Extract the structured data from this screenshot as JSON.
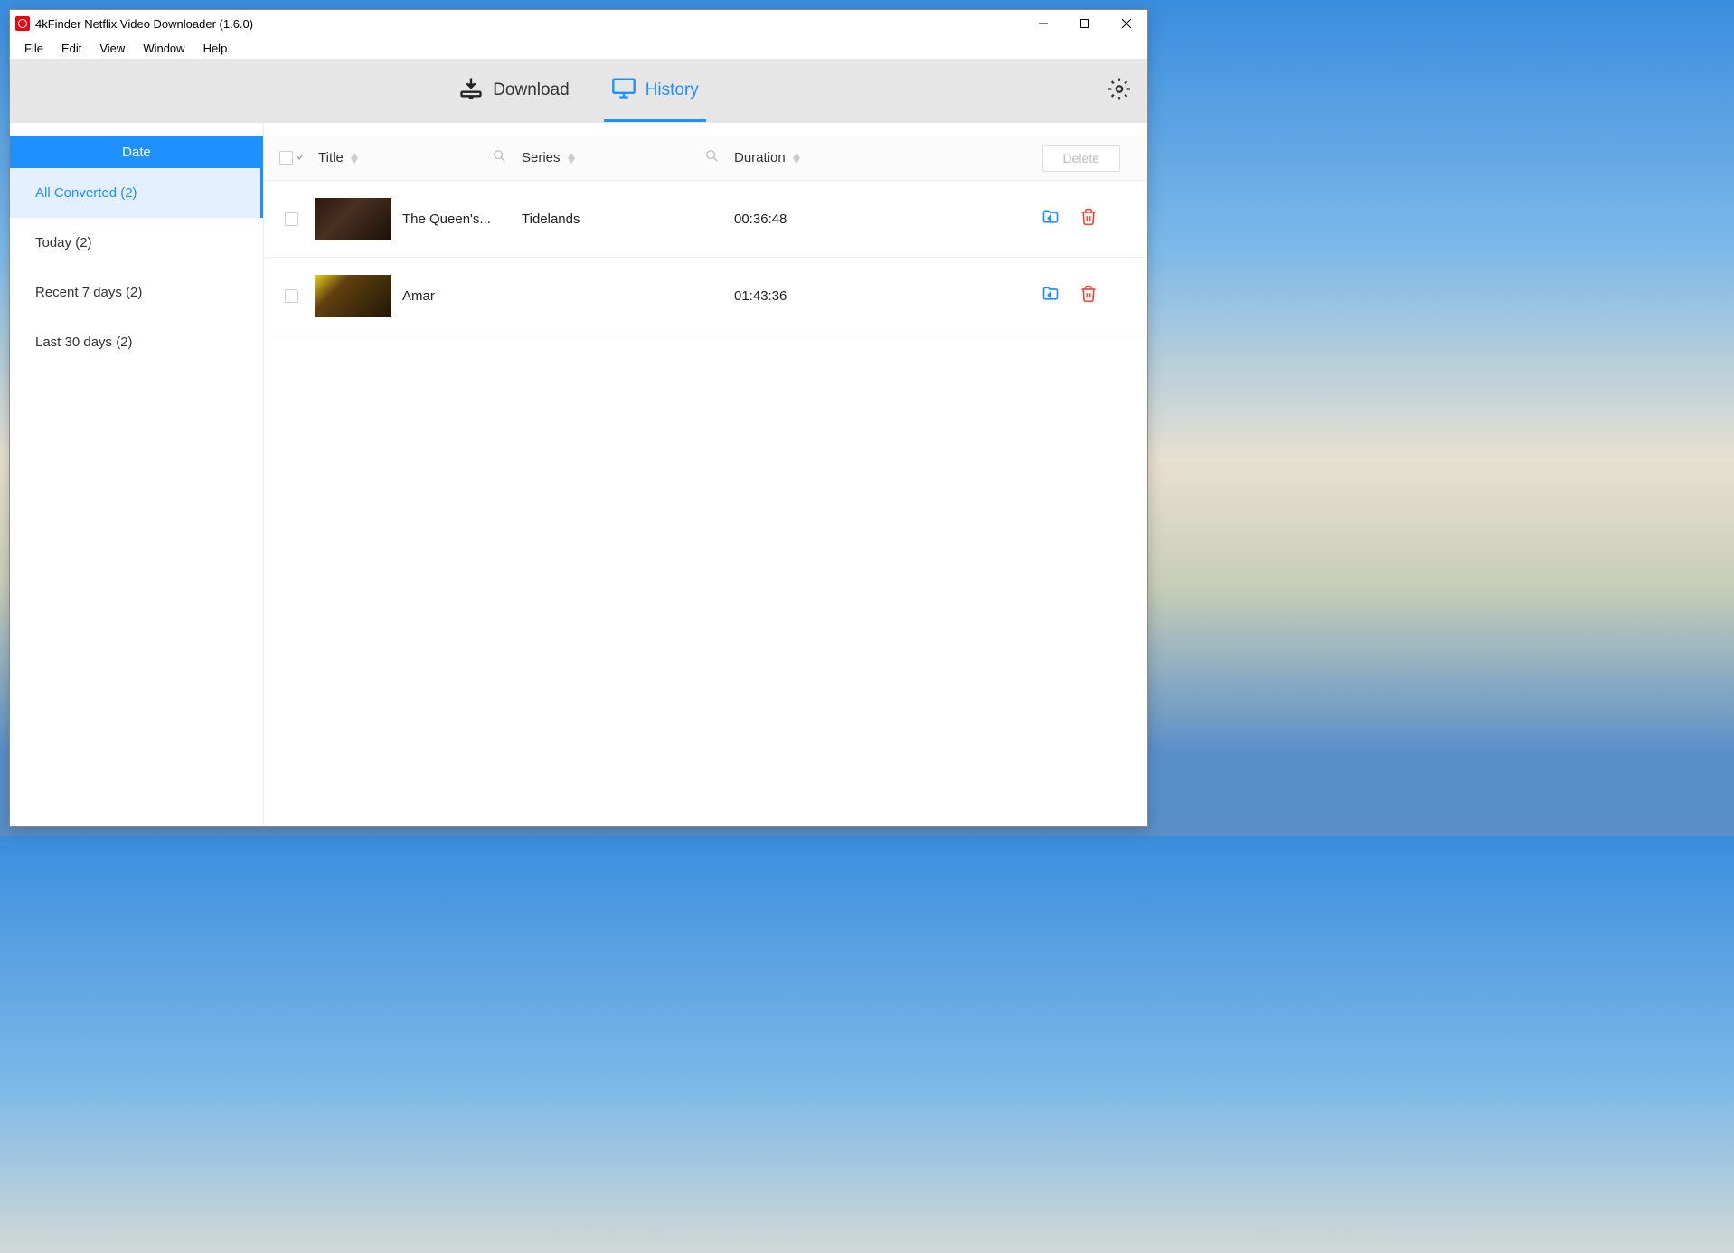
{
  "window": {
    "title": "4kFinder Netflix Video Downloader (1.6.0)"
  },
  "menubar": {
    "items": [
      "File",
      "Edit",
      "View",
      "Window",
      "Help"
    ]
  },
  "tabs": {
    "download": "Download",
    "history": "History"
  },
  "sidebar": {
    "header": "Date",
    "items": [
      {
        "label": "All Converted (2)",
        "selected": true
      },
      {
        "label": "Today (2)",
        "selected": false
      },
      {
        "label": "Recent 7 days (2)",
        "selected": false
      },
      {
        "label": "Last 30 days (2)",
        "selected": false
      }
    ]
  },
  "table": {
    "columns": {
      "title": "Title",
      "series": "Series",
      "duration": "Duration"
    },
    "delete_label": "Delete",
    "rows": [
      {
        "title": "The Queen's...",
        "series": "Tidelands",
        "duration": "00:36:48"
      },
      {
        "title": "Amar",
        "series": "",
        "duration": "01:43:36"
      }
    ]
  }
}
